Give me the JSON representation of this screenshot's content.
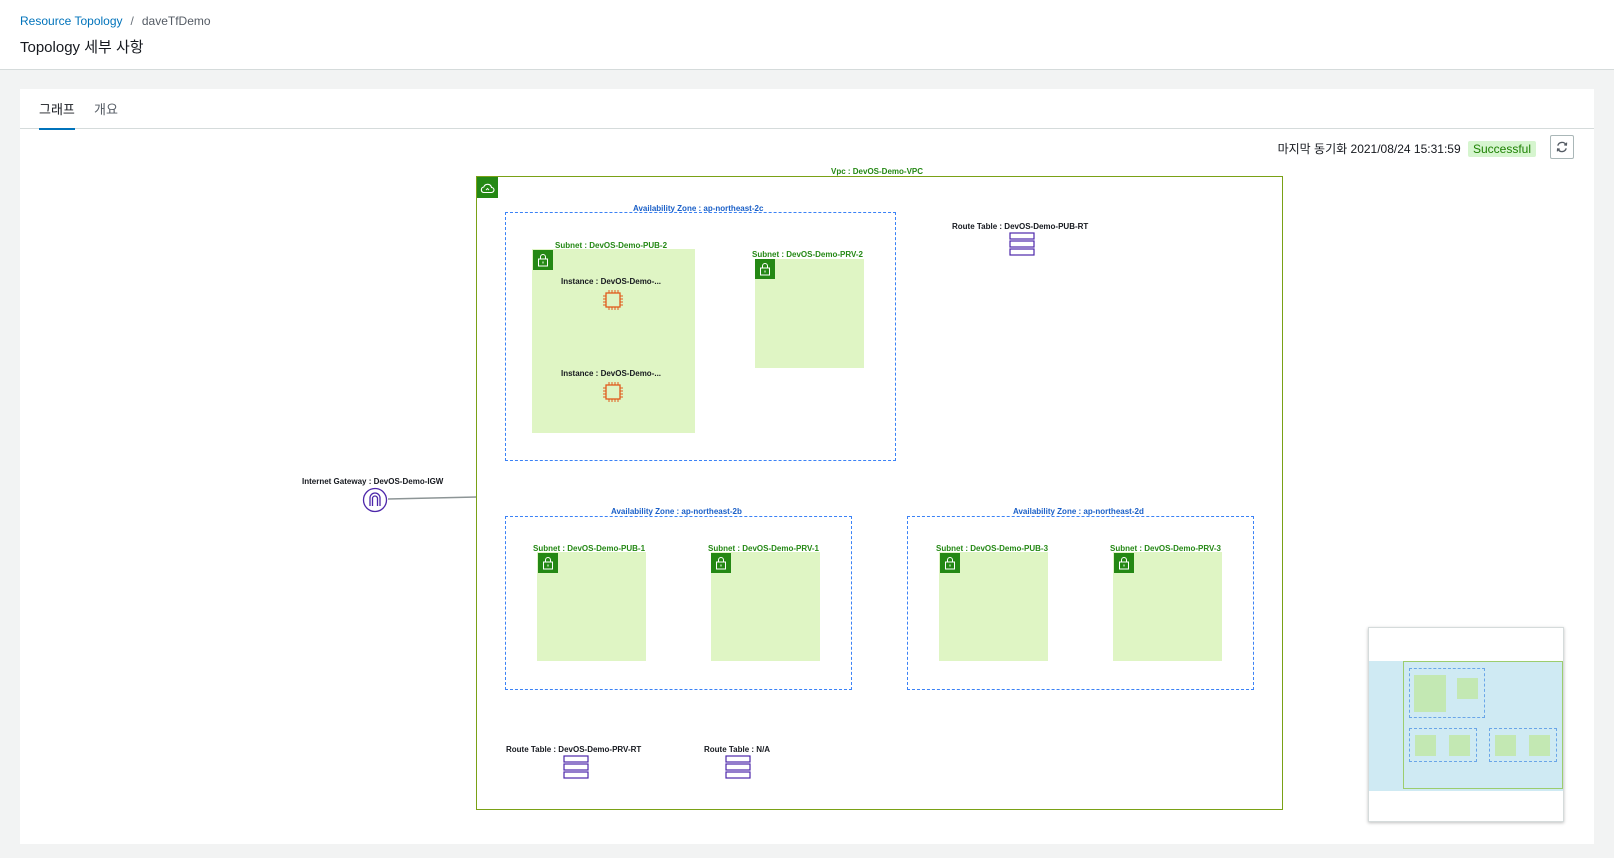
{
  "breadcrumb": {
    "root": "Resource Topology",
    "separator": "/",
    "current": "daveTfDemo"
  },
  "page": {
    "title": "Topology 세부 사항"
  },
  "tabs": [
    {
      "label": "그래프"
    },
    {
      "label": "개요"
    }
  ],
  "sync": {
    "label": "마지막 동기화",
    "timestamp": "2021/08/24 15:31:59",
    "status": "Successful"
  },
  "topology": {
    "vpc": {
      "label": "Vpc : DevOS-Demo-VPC",
      "icon": "cloud-icon"
    },
    "internet_gateway": {
      "label": "Internet Gateway : DevOS-Demo-IGW",
      "icon": "internet-gateway-icon"
    },
    "availability_zones": [
      {
        "label": "Availability Zone : ap-northeast-2c",
        "subnets": [
          {
            "label": "Subnet : DevOS-Demo-PUB-2",
            "instances": [
              {
                "label": "Instance : DevOS-Demo-..."
              },
              {
                "label": "Instance : DevOS-Demo-..."
              }
            ]
          },
          {
            "label": "Subnet : DevOS-Demo-PRV-2"
          }
        ]
      },
      {
        "label": "Availability Zone : ap-northeast-2b",
        "subnets": [
          {
            "label": "Subnet : DevOS-Demo-PUB-1"
          },
          {
            "label": "Subnet : DevOS-Demo-PRV-1"
          }
        ]
      },
      {
        "label": "Availability Zone : ap-northeast-2d",
        "subnets": [
          {
            "label": "Subnet : DevOS-Demo-PUB-3"
          },
          {
            "label": "Subnet : DevOS-Demo-PRV-3"
          }
        ]
      }
    ],
    "route_tables": [
      {
        "label": "Route Table : DevOS-Demo-PUB-RT"
      },
      {
        "label": "Route Table : DevOS-Demo-PRV-RT"
      },
      {
        "label": "Route Table : N/A"
      }
    ]
  },
  "colors": {
    "link": "#0073bb",
    "vpc_border": "#7aa116",
    "subnet_fill": "#dff5c4",
    "group_green": "#248814",
    "az_border": "#3b82f6",
    "route_table": "#4d27aa",
    "instance": "#e05a1b",
    "status_success": "#1d8102"
  }
}
